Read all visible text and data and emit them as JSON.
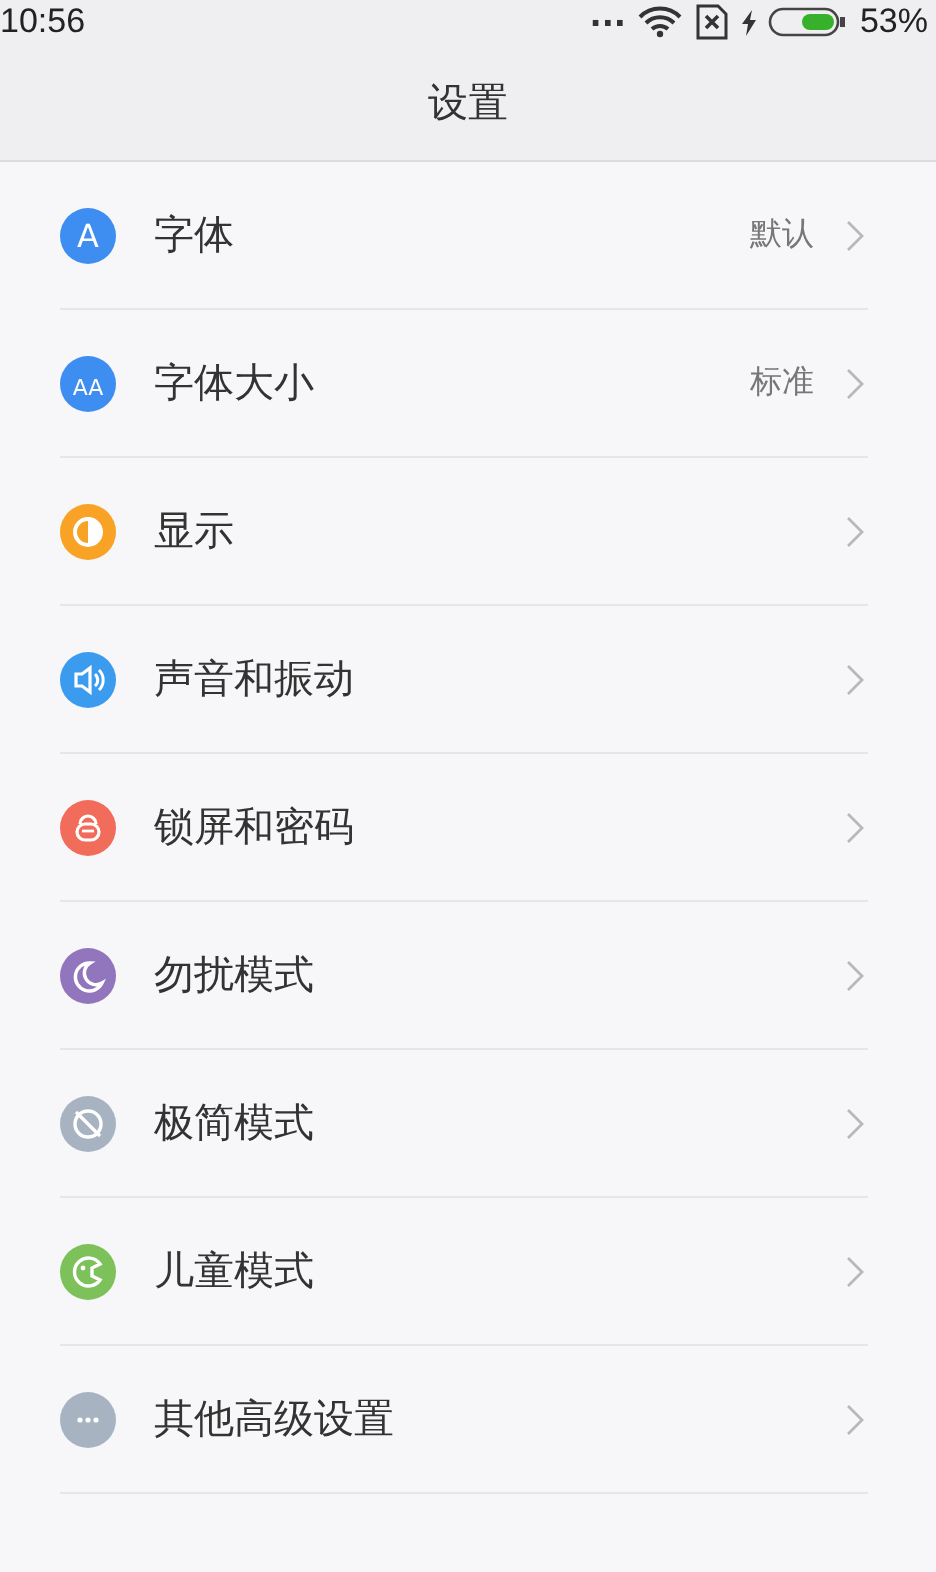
{
  "status_bar": {
    "time": "10:56",
    "dots": "...",
    "battery_percent": "53%"
  },
  "title": "设置",
  "items": [
    {
      "label": "字体",
      "value": "默认",
      "kind": "font",
      "glyph": "A",
      "color": "#3d8ef0"
    },
    {
      "label": "字体大小",
      "value": "标准",
      "kind": "font",
      "glyph": "AA",
      "color": "#3d8ef0"
    },
    {
      "label": "显示",
      "kind": "display",
      "color": "#f8a226"
    },
    {
      "label": "声音和振动",
      "kind": "sound",
      "color": "#3a9bef"
    },
    {
      "label": "锁屏和密码",
      "kind": "lock",
      "color": "#f26c5b"
    },
    {
      "label": "勿扰模式",
      "kind": "moon",
      "color": "#9176bd"
    },
    {
      "label": "极简模式",
      "kind": "minimal",
      "color": "#a8b3c1"
    },
    {
      "label": "儿童模式",
      "kind": "child",
      "color": "#7cc15a"
    },
    {
      "label": "其他高级设置",
      "kind": "more",
      "color": "#a8b3c1"
    }
  ]
}
